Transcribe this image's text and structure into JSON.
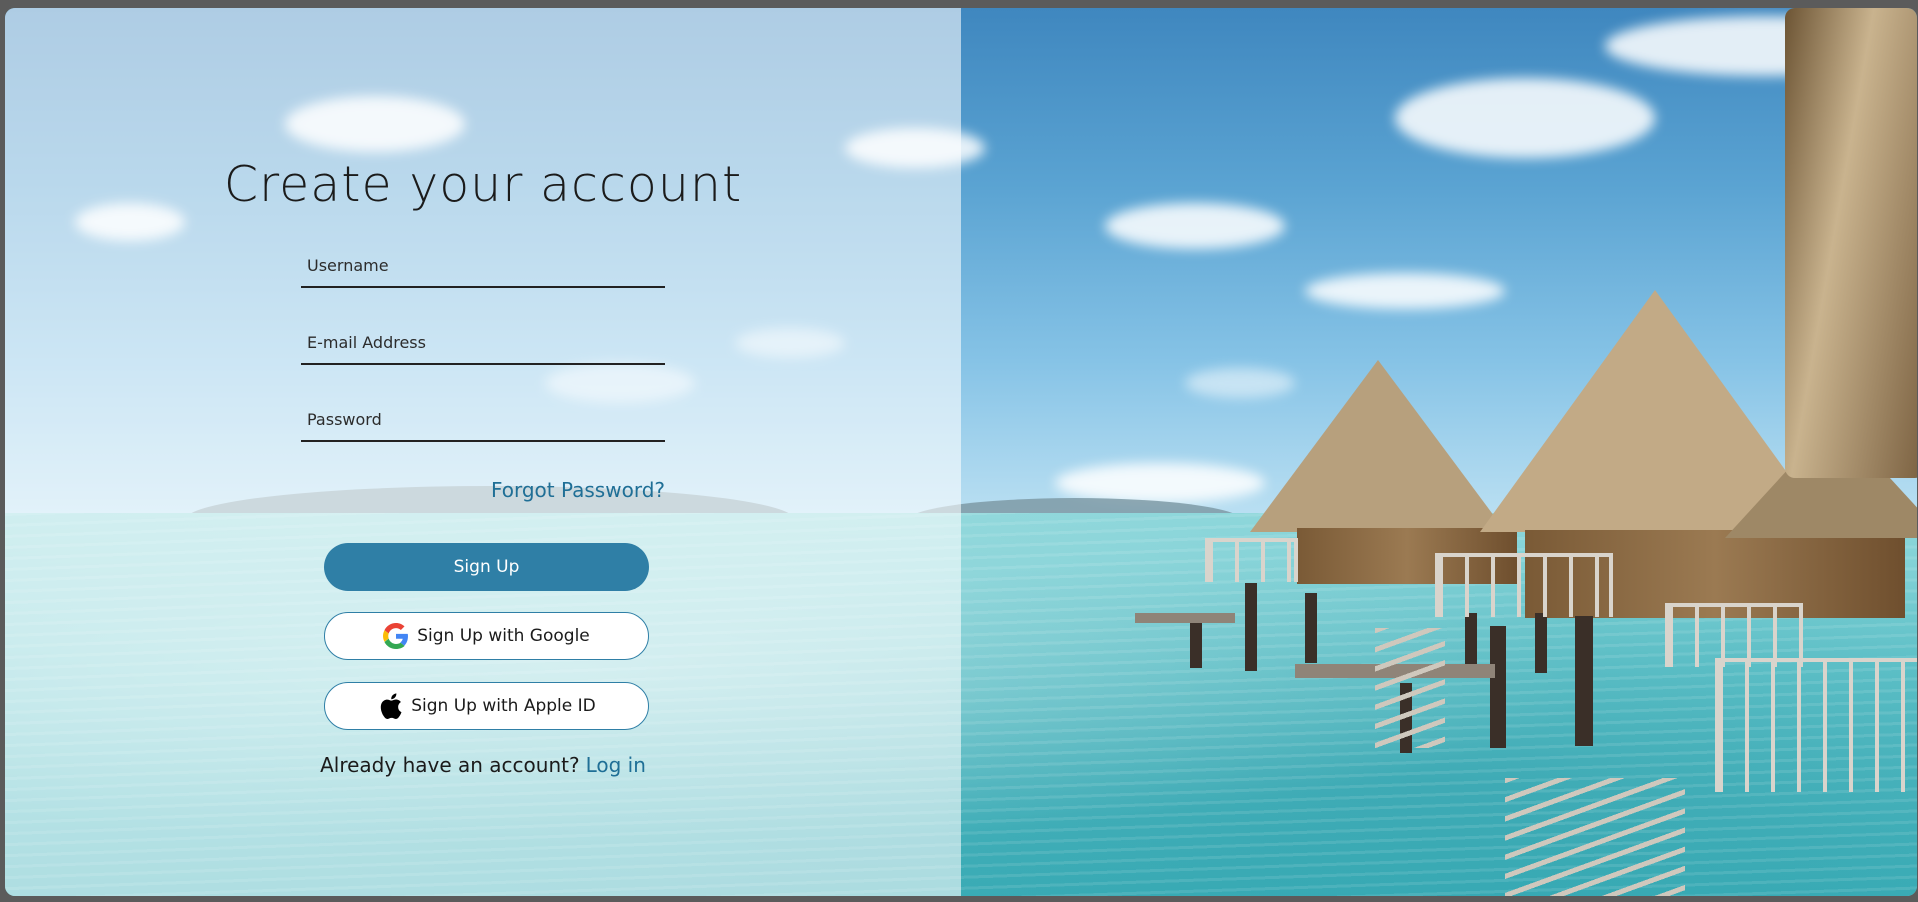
{
  "form": {
    "title": "Create your account",
    "username_placeholder": "Username",
    "email_placeholder": "E-mail Address",
    "password_placeholder": "Password",
    "forgot_password": "Forgot Password?",
    "signup_label": "Sign Up",
    "google_label": "Sign Up with Google",
    "apple_label": "Sign Up with Apple ID",
    "already_text": "Already have an account?",
    "login_label": "Log in"
  },
  "icons": {
    "google": "google-icon",
    "apple": "apple-icon"
  },
  "colors": {
    "accent": "#2f7fa6",
    "link": "#1f6f96"
  }
}
